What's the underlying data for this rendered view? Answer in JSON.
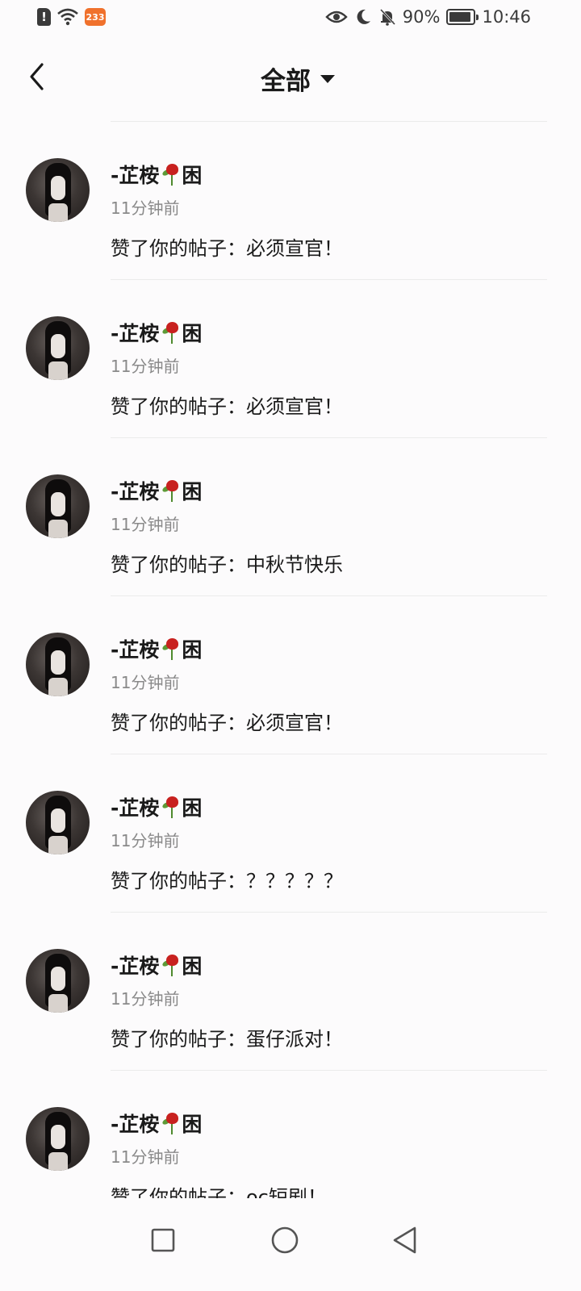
{
  "status_bar": {
    "app_badge": "233",
    "battery": "90%",
    "battery_level": 0.9,
    "time": "10:46"
  },
  "header": {
    "title": "全部"
  },
  "notifications": [
    {
      "user": "-芷桉",
      "user_suffix": "困",
      "time": "11分钟前",
      "content": "赞了你的帖子：必须宣官！"
    },
    {
      "user": "-芷桉",
      "user_suffix": "困",
      "time": "11分钟前",
      "content": "赞了你的帖子：必须宣官！"
    },
    {
      "user": "-芷桉",
      "user_suffix": "困",
      "time": "11分钟前",
      "content": "赞了你的帖子：中秋节快乐"
    },
    {
      "user": "-芷桉",
      "user_suffix": "困",
      "time": "11分钟前",
      "content": "赞了你的帖子：必须宣官！"
    },
    {
      "user": "-芷桉",
      "user_suffix": "困",
      "time": "11分钟前",
      "content": "赞了你的帖子：？？？？？"
    },
    {
      "user": "-芷桉",
      "user_suffix": "困",
      "time": "11分钟前",
      "content": "赞了你的帖子：蛋仔派对！"
    },
    {
      "user": "-芷桉",
      "user_suffix": "困",
      "time": "11分钟前",
      "content": "赞了你的帖子：oc短剧！"
    }
  ],
  "icons": {
    "back": "chevron-left-icon",
    "dropdown": "caret-down-icon",
    "rose": "wilted-rose-icon",
    "nav_recents": "square-icon",
    "nav_home": "circle-icon",
    "nav_back": "triangle-back-icon"
  }
}
